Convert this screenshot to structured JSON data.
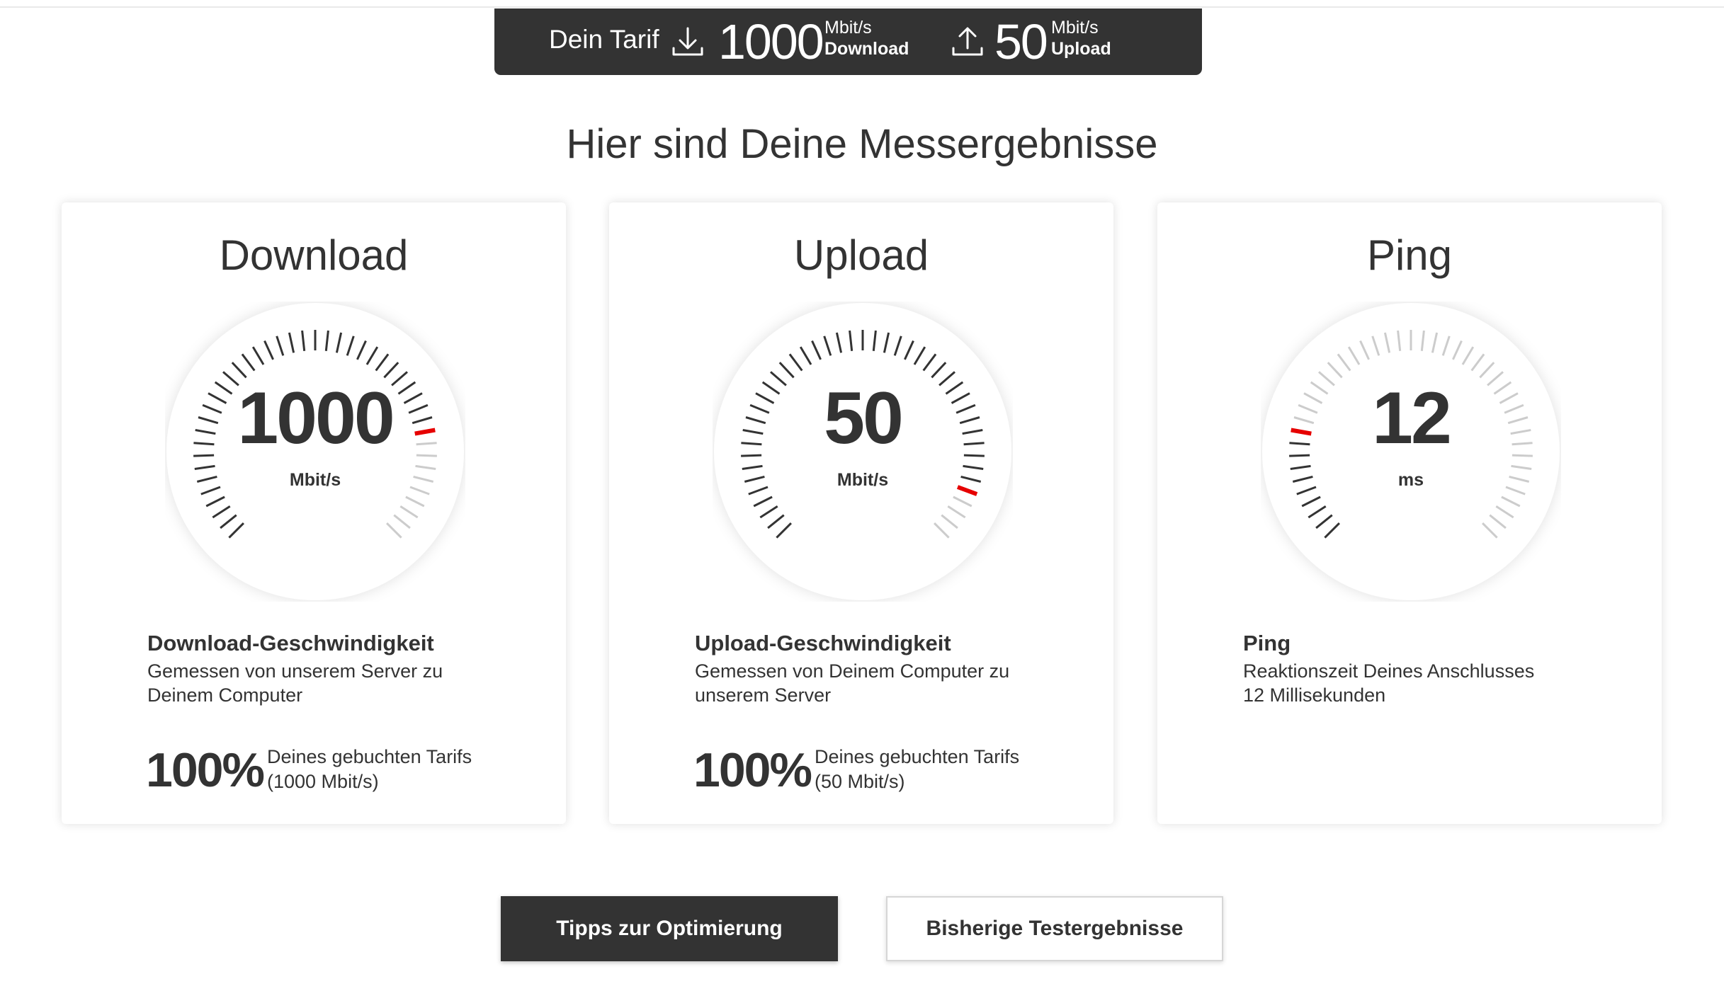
{
  "tarif": {
    "label": "Dein Tarif",
    "download_value": "1000",
    "download_unit": "Mbit/s",
    "download_label": "Download",
    "upload_value": "50",
    "upload_unit": "Mbit/s",
    "upload_label": "Upload",
    "download_icon": "download-arrow-icon",
    "upload_icon": "upload-arrow-icon"
  },
  "heading": "Hier sind Deine Messergebnisse",
  "cards": [
    {
      "title": "Download",
      "value": "1000",
      "unit": "Mbit/s",
      "gauge_fraction": 0.8,
      "metric_title": "Download-Geschwindigkeit",
      "desc_line1": "Gemessen von unserem Server zu",
      "desc_line2": "Deinem Computer",
      "percent": "100%",
      "percent_note_line1": "Deines gebuchten Tarifs",
      "percent_note_line2": "(1000 Mbit/s)"
    },
    {
      "title": "Upload",
      "value": "50",
      "unit": "Mbit/s",
      "gauge_fraction": 0.9,
      "metric_title": "Upload-Geschwindigkeit",
      "desc_line1": "Gemessen von Deinem Computer zu",
      "desc_line2": "unserem Server",
      "percent": "100%",
      "percent_note_line1": "Deines gebuchten Tarifs",
      "percent_note_line2": "(50 Mbit/s)"
    },
    {
      "title": "Ping",
      "value": "12",
      "unit": "ms",
      "gauge_fraction": 0.2,
      "metric_title": "Ping",
      "desc_line1": "Reaktionszeit Deines Anschlusses",
      "desc_line2": "12 Millisekunden"
    }
  ],
  "buttons": {
    "tips_label": "Tipps zur Optimierung",
    "history_label": "Bisherige Testergebnisse"
  },
  "colors": {
    "dark": "#333333",
    "accent_red": "#e60000",
    "tick_inactive": "#cccccc"
  }
}
